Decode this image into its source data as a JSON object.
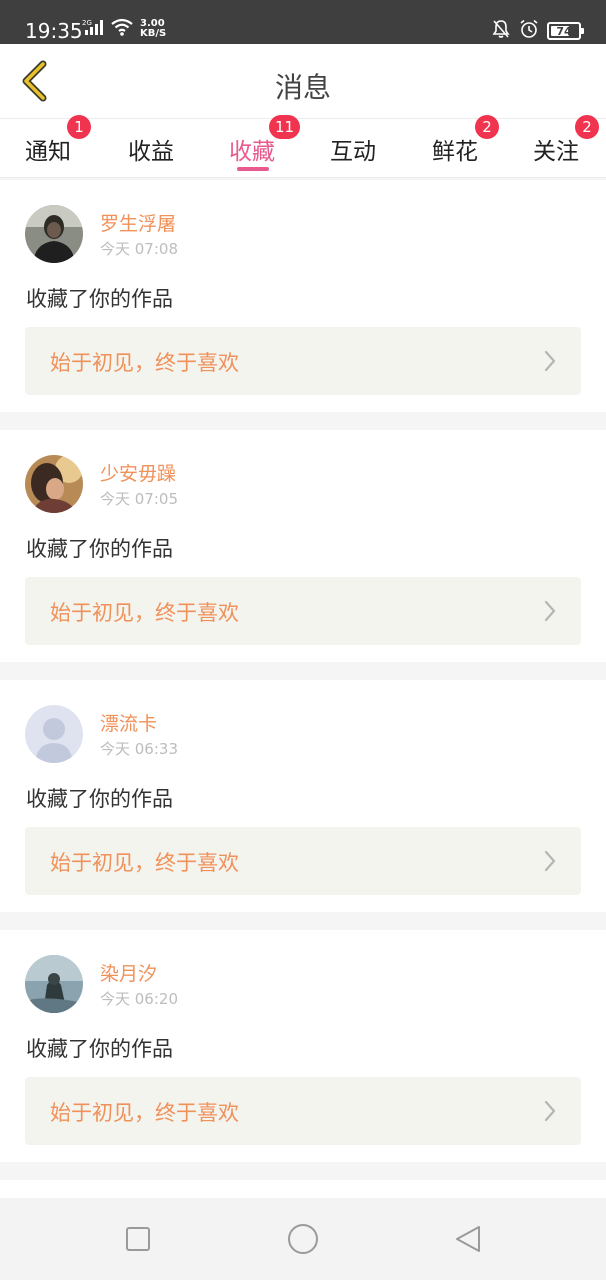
{
  "status_bar": {
    "time": "19:35",
    "net_type": "2G",
    "net_speed_value": "3.00",
    "net_speed_unit": "KB/S",
    "battery_level": "74",
    "battery_fraction": 0.74
  },
  "header": {
    "title": "消息"
  },
  "tabs": [
    {
      "label": "通知",
      "badge": "1",
      "active": false
    },
    {
      "label": "收益",
      "badge": "",
      "active": false
    },
    {
      "label": "收藏",
      "badge": "11",
      "active": true
    },
    {
      "label": "互动",
      "badge": "",
      "active": false
    },
    {
      "label": "鲜花",
      "badge": "2",
      "active": false
    },
    {
      "label": "关注",
      "badge": "2",
      "active": false
    }
  ],
  "items": [
    {
      "user": "罗生浮屠",
      "time": "今天 07:08",
      "action": "收藏了你的作品",
      "work": "始于初见，终于喜欢",
      "avatar": "avatar-photo-man"
    },
    {
      "user": "少安毋躁",
      "time": "今天 07:05",
      "action": "收藏了你的作品",
      "work": "始于初见，终于喜欢",
      "avatar": "avatar-photo-warm"
    },
    {
      "user": "漂流卡",
      "time": "今天 06:33",
      "action": "收藏了你的作品",
      "work": "始于初见，终于喜欢",
      "avatar": "default-avatar"
    },
    {
      "user": "染月汐",
      "time": "今天 06:20",
      "action": "收藏了你的作品",
      "work": "始于初见，终于喜欢",
      "avatar": "avatar-photo-figure"
    }
  ],
  "colors": {
    "accent_pink": "#e85a8d",
    "accent_orange": "#f0915a",
    "badge_red": "#f0334e",
    "back_arrow": "#e9c12a"
  },
  "nav_bar": {
    "icons": [
      "recent-apps-icon",
      "home-icon",
      "back-icon"
    ]
  }
}
